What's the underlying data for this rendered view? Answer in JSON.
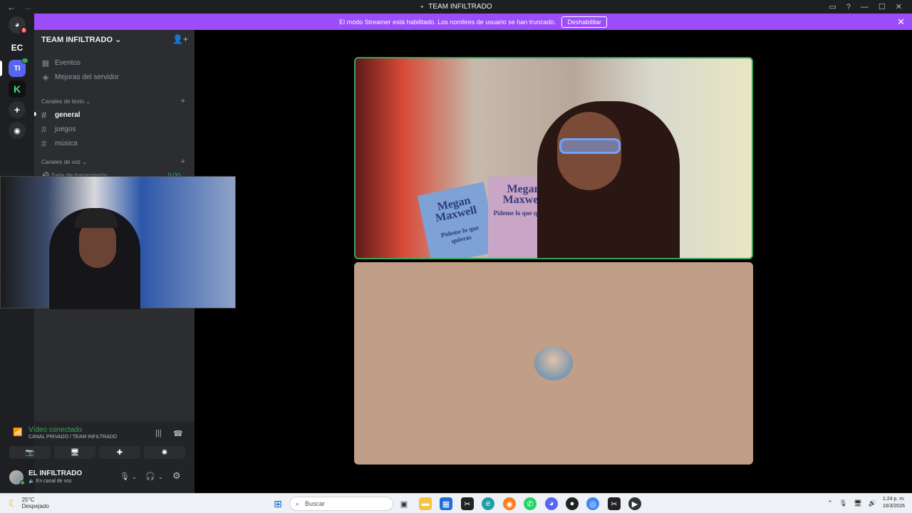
{
  "window": {
    "title": "TEAM INFILTRADO",
    "back": "←",
    "forward": "→"
  },
  "banner": {
    "text": "El modo Streamer está habilitado. Los nombres de usuario se han truncado.",
    "button": "Deshabilitar"
  },
  "guilds": {
    "ec": "EC",
    "ti": "TI",
    "k": "K",
    "home_badge": "1"
  },
  "sidebar": {
    "server_name": "TEAM INFILTRADO",
    "items": [
      {
        "label": "Eventos"
      },
      {
        "label": "Mejoras del servidor"
      }
    ],
    "text_category": "Canales de texto",
    "text_channels": [
      {
        "label": "general"
      },
      {
        "label": "juegos"
      },
      {
        "label": "música"
      }
    ],
    "voice_category": "Canales de voz",
    "voice_channel": {
      "label": "Sala de transmisión",
      "time": "0:00"
    }
  },
  "voice": {
    "status": "Vídeo conectado",
    "sub": "CANAL PRIVADO / TEAM INFILTRADO"
  },
  "user": {
    "name": "EL INFILTRADO",
    "status": "En canal de voz"
  },
  "video": {
    "book_title": "Megan Maxwell",
    "book_sub": "Pídeme lo que quieras"
  },
  "taskbar": {
    "temp": "25°C",
    "weather": "Despejado",
    "search_placeholder": "Buscar",
    "time": "1:24 p. m.",
    "date": "16/3/2026"
  },
  "colors": {
    "accent": "#9b4dfa",
    "connected": "#3ba55c",
    "tile2_bg": "#c19e87"
  }
}
